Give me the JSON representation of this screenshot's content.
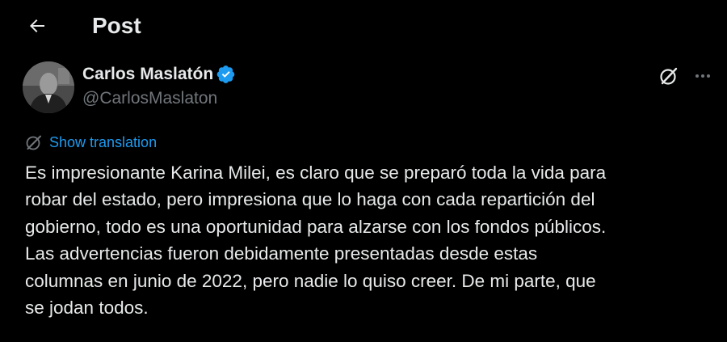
{
  "header": {
    "title": "Post",
    "back_icon": "arrow-left-icon"
  },
  "author": {
    "display_name": "Carlos Maslatón",
    "handle": "@CarlosMaslaton",
    "verified_icon": "verified-badge-icon",
    "badge_color": "#1d9bf0"
  },
  "actions": {
    "grok_icon": "grok-icon",
    "more_icon": "more-horizontal-icon"
  },
  "translation": {
    "label": "Show translation",
    "icon": "translate-globe-icon",
    "color": "#1d9bf0"
  },
  "tweet": {
    "lines": [
      "Es impresionante Karina Milei, es claro que se preparó toda la vida para",
      "robar del estado, pero impresiona que lo haga con cada repartición del",
      "gobierno, todo es una oportunidad para alzarse con los fondos públicos.",
      "Las advertencias fueron debidamente presentadas desde estas",
      "columnas en junio de 2022, pero nadie lo quiso creer. De mi parte, que",
      "se jodan todos."
    ]
  },
  "colors": {
    "background": "#000000",
    "text_primary": "#e7e9ea",
    "text_secondary": "#71767b",
    "accent": "#1d9bf0"
  }
}
